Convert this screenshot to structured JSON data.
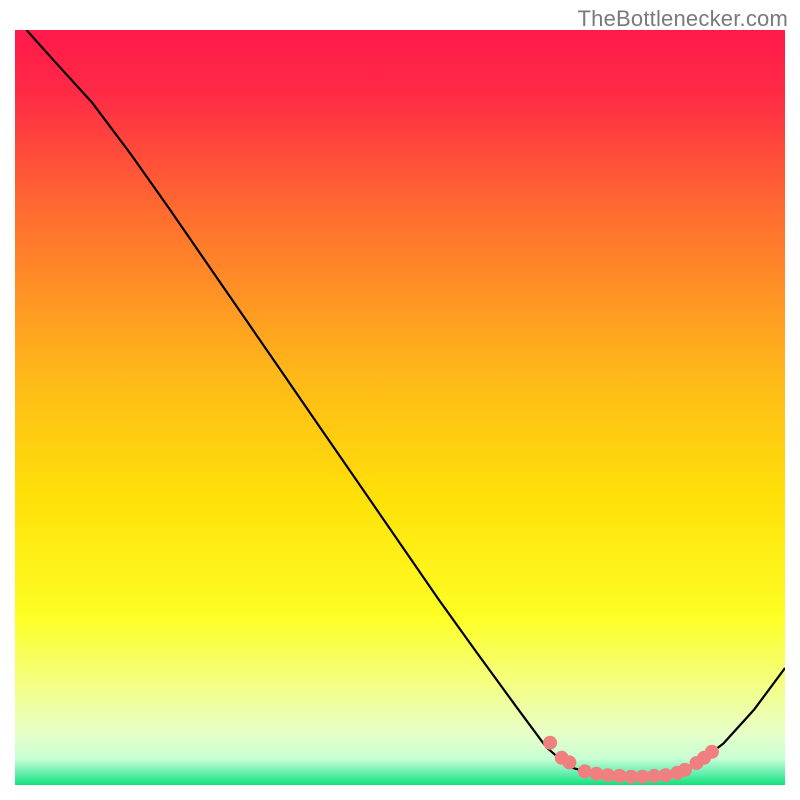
{
  "header": {
    "watermark": "TheBottlenecker.com"
  },
  "chart_data": {
    "type": "line",
    "title": "",
    "xlabel": "",
    "ylabel": "",
    "x_range": [
      0,
      100
    ],
    "y_range": [
      0,
      100
    ],
    "series": [
      {
        "name": "curve",
        "color": "#000000",
        "points": [
          {
            "x": 1.5,
            "y": 100
          },
          {
            "x": 5.0,
            "y": 96
          },
          {
            "x": 10.0,
            "y": 90.4
          },
          {
            "x": 15.0,
            "y": 83.6
          },
          {
            "x": 20.0,
            "y": 76.4
          },
          {
            "x": 25.0,
            "y": 69.0
          },
          {
            "x": 30.0,
            "y": 61.6
          },
          {
            "x": 35.0,
            "y": 54.2
          },
          {
            "x": 40.0,
            "y": 46.8
          },
          {
            "x": 45.0,
            "y": 39.4
          },
          {
            "x": 50.0,
            "y": 32.0
          },
          {
            "x": 55.0,
            "y": 24.6
          },
          {
            "x": 60.0,
            "y": 17.5
          },
          {
            "x": 65.0,
            "y": 10.5
          },
          {
            "x": 69.0,
            "y": 5.0
          },
          {
            "x": 72.0,
            "y": 2.4
          },
          {
            "x": 76.0,
            "y": 1.2
          },
          {
            "x": 80.0,
            "y": 1.0
          },
          {
            "x": 84.0,
            "y": 1.2
          },
          {
            "x": 88.0,
            "y": 2.4
          },
          {
            "x": 92.0,
            "y": 5.5
          },
          {
            "x": 96.0,
            "y": 10.0
          },
          {
            "x": 100.0,
            "y": 15.5
          }
        ]
      }
    ],
    "markers": [
      {
        "x": 69.5,
        "y": 5.6
      },
      {
        "x": 71.0,
        "y": 3.6
      },
      {
        "x": 72.0,
        "y": 3.0
      },
      {
        "x": 74.0,
        "y": 1.8
      },
      {
        "x": 75.5,
        "y": 1.5
      },
      {
        "x": 77.0,
        "y": 1.3
      },
      {
        "x": 78.5,
        "y": 1.2
      },
      {
        "x": 80.0,
        "y": 1.1
      },
      {
        "x": 81.5,
        "y": 1.1
      },
      {
        "x": 83.0,
        "y": 1.2
      },
      {
        "x": 84.5,
        "y": 1.3
      },
      {
        "x": 86.0,
        "y": 1.6
      },
      {
        "x": 87.0,
        "y": 2.0
      },
      {
        "x": 88.5,
        "y": 2.9
      },
      {
        "x": 89.5,
        "y": 3.6
      },
      {
        "x": 90.5,
        "y": 4.4
      }
    ],
    "colors": {
      "gradient_top": "#ff1a4a",
      "gradient_mid": "#ffe108",
      "gradient_band": "#ecffdf",
      "gradient_bottom": "#0fe27a",
      "marker": "#f08080"
    }
  }
}
